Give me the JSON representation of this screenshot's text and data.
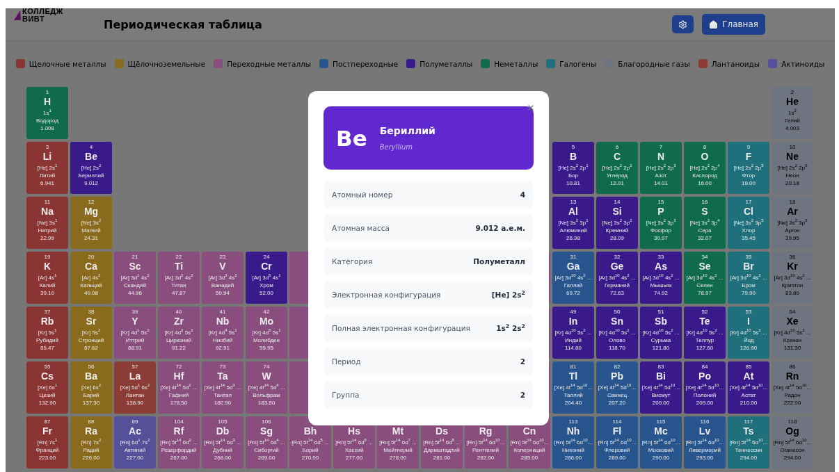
{
  "header": {
    "logo": [
      "КОЛЛЕДЖ",
      "ВИВТ"
    ],
    "title": "Периодическая таблица",
    "buttons": [
      {
        "kind": "settings"
      },
      {
        "kind": "home",
        "label": "Главная"
      }
    ]
  },
  "legend": [
    {
      "label": "Щелочные металлы",
      "color": "#8a3434"
    },
    {
      "label": "Щёлочноземельные",
      "color": "#8a6a1c"
    },
    {
      "label": "Переходные металлы",
      "color": "#8a4e7e"
    },
    {
      "label": "Постпереходные",
      "color": "#28558e"
    },
    {
      "label": "Полуметаллы",
      "color": "#3a1a8a"
    },
    {
      "label": "Неметаллы",
      "color": "#106a4c"
    },
    {
      "label": "Галогены",
      "color": "#1f6f7c"
    },
    {
      "label": "Благородные газы",
      "color": "#6e7480"
    },
    {
      "label": "Лантаноиды",
      "color": "#8c3c36"
    },
    {
      "label": "Актиноиды",
      "color": "#55509a"
    }
  ],
  "table": {
    "rows": [
      [
        {
          "kind": "element",
          "color": "#106a4c",
          "number": "1",
          "symbol": "H",
          "config": "1s$^{1}$",
          "name": "Водород",
          "mass": "1.008"
        },
        {
          "kind": "empty"
        },
        {
          "kind": "empty"
        },
        {
          "kind": "empty"
        },
        {
          "kind": "empty"
        },
        {
          "kind": "empty"
        },
        {
          "kind": "empty"
        },
        {
          "kind": "empty"
        },
        {
          "kind": "empty"
        },
        {
          "kind": "empty"
        },
        {
          "kind": "empty"
        },
        {
          "kind": "empty"
        },
        {
          "kind": "empty"
        },
        {
          "kind": "empty"
        },
        {
          "kind": "empty"
        },
        {
          "kind": "empty"
        },
        {
          "kind": "empty"
        },
        {
          "kind": "element",
          "color": "#6e7480",
          "number": "2",
          "symbol": "He",
          "config": "1s$^{2}$",
          "name": "Гелий",
          "mass": "4.003"
        }
      ],
      [
        {
          "kind": "element",
          "color": "#8a3434",
          "number": "3",
          "symbol": "Li",
          "config": "[He] 2s$^{1}$",
          "name": "Литий",
          "mass": "6.941"
        },
        {
          "kind": "element",
          "color": "#3a1a8a",
          "number": "4",
          "symbol": "Be",
          "config": "[He] 2s$^{2}$",
          "name": "Бериллий",
          "mass": "9.012"
        },
        {
          "kind": "empty"
        },
        {
          "kind": "empty"
        },
        {
          "kind": "empty"
        },
        {
          "kind": "empty"
        },
        {
          "kind": "empty"
        },
        {
          "kind": "empty"
        },
        {
          "kind": "empty"
        },
        {
          "kind": "empty"
        },
        {
          "kind": "empty"
        },
        {
          "kind": "empty"
        },
        {
          "kind": "element",
          "color": "#3a1a8a",
          "number": "5",
          "symbol": "B",
          "config": "[He] 2s$^{2}$ 2p$^{1}$",
          "name": "Бор",
          "mass": "10.81"
        },
        {
          "kind": "element",
          "color": "#106a4c",
          "number": "6",
          "symbol": "C",
          "config": "[He] 2s$^{2}$ 2p$^{2}$",
          "name": "Углерод",
          "mass": "12.01"
        },
        {
          "kind": "element",
          "color": "#106a4c",
          "number": "7",
          "symbol": "N",
          "config": "[He] 2s$^{2}$ 2p$^{3}$",
          "name": "Азот",
          "mass": "14.01"
        },
        {
          "kind": "element",
          "color": "#106a4c",
          "number": "8",
          "symbol": "O",
          "config": "[He] 2s$^{2}$ 2p$^{4}$",
          "name": "Кислород",
          "mass": "16.00"
        },
        {
          "kind": "element",
          "color": "#1f6f7c",
          "number": "9",
          "symbol": "F",
          "config": "[He] 2s$^{2}$ 2p$^{5}$",
          "name": "Фтор",
          "mass": "19.00"
        },
        {
          "kind": "element",
          "color": "#6e7480",
          "number": "10",
          "symbol": "Ne",
          "config": "[He] 2s$^{2}$ 2p$^{6}$",
          "name": "Неон",
          "mass": "20.18"
        }
      ],
      [
        {
          "kind": "element",
          "color": "#8a3434",
          "number": "11",
          "symbol": "Na",
          "config": "[Ne] 3s$^{1}$",
          "name": "Натрий",
          "mass": "22.99"
        },
        {
          "kind": "element",
          "color": "#8a6a1c",
          "number": "12",
          "symbol": "Mg",
          "config": "[Ne] 3s$^{2}$",
          "name": "Магний",
          "mass": "24.31"
        },
        {
          "kind": "empty"
        },
        {
          "kind": "empty"
        },
        {
          "kind": "empty"
        },
        {
          "kind": "empty"
        },
        {
          "kind": "empty"
        },
        {
          "kind": "empty"
        },
        {
          "kind": "empty"
        },
        {
          "kind": "empty"
        },
        {
          "kind": "empty"
        },
        {
          "kind": "empty"
        },
        {
          "kind": "element",
          "color": "#3a1a8a",
          "number": "13",
          "symbol": "Al",
          "config": "[Ne] 3s$^{2}$ 3p$^{1}$",
          "name": "Алюминий",
          "mass": "26.98"
        },
        {
          "kind": "element",
          "color": "#3a1a8a",
          "number": "14",
          "symbol": "Si",
          "config": "[Ne] 3s$^{2}$ 3p$^{2}$",
          "name": "Кремний",
          "mass": "28.09"
        },
        {
          "kind": "element",
          "color": "#106a4c",
          "number": "15",
          "symbol": "P",
          "config": "[Ne] 3s$^{2}$ 3p$^{3}$",
          "name": "Фосфор",
          "mass": "30.97"
        },
        {
          "kind": "element",
          "color": "#106a4c",
          "number": "16",
          "symbol": "S",
          "config": "[Ne] 3s$^{2}$ 3p$^{4}$",
          "name": "Сера",
          "mass": "32.07"
        },
        {
          "kind": "element",
          "color": "#1f6f7c",
          "number": "17",
          "symbol": "Cl",
          "config": "[Ne] 3s$^{2}$ 3p$^{5}$",
          "name": "Хлор",
          "mass": "35.45"
        },
        {
          "kind": "element",
          "color": "#6e7480",
          "number": "18",
          "symbol": "Ar",
          "config": "[Ne] 3s$^{2}$ 3p$^{6}$",
          "name": "Аргон",
          "mass": "39.95"
        }
      ],
      [
        {
          "kind": "element",
          "color": "#8a3434",
          "number": "19",
          "symbol": "K",
          "config": "[Ar] 4s$^{1}$",
          "name": "Калий",
          "mass": "39.10"
        },
        {
          "kind": "element",
          "color": "#8a6a1c",
          "number": "20",
          "symbol": "Ca",
          "config": "[Ar] 4s$^{2}$",
          "name": "Кальций",
          "mass": "40.08"
        },
        {
          "kind": "element",
          "color": "#8a4e7e",
          "number": "21",
          "symbol": "Sc",
          "config": "[Ar] 3d$^{1}$ 4s$^{2}$",
          "name": "Скандий",
          "mass": "44.96"
        },
        {
          "kind": "element",
          "color": "#8a4e7e",
          "number": "22",
          "symbol": "Ti",
          "config": "[Ar] 3d$^{2}$ 4s$^{2}$",
          "name": "Титан",
          "mass": "47.87"
        },
        {
          "kind": "element",
          "color": "#8a4e7e",
          "number": "23",
          "symbol": "V",
          "config": "[Ar] 3d$^{3}$ 4s$^{2}$",
          "name": "Ванадий",
          "mass": "50.94"
        },
        {
          "kind": "element",
          "color": "#3a1a8a",
          "number": "24",
          "symbol": "Cr",
          "config": "[Ar] 3d$^{5}$ 4s$^{1}$",
          "name": "Хром",
          "mass": "52.00"
        },
        {
          "kind": "covered",
          "color": "#8a4e7e"
        },
        {
          "kind": "empty"
        },
        {
          "kind": "empty"
        },
        {
          "kind": "empty"
        },
        {
          "kind": "empty"
        },
        {
          "kind": "covered",
          "color": "#8a4e7e"
        },
        {
          "kind": "element",
          "color": "#28558e",
          "number": "31",
          "symbol": "Ga",
          "config": "[Ar] 3d$^{10}$ 4s$^{2}$ ...",
          "name": "Галлий",
          "mass": "69.72"
        },
        {
          "kind": "element",
          "color": "#3a1a8a",
          "number": "32",
          "symbol": "Ge",
          "config": "[Ar] 3d$^{10}$ 4s$^{2}$ ...",
          "name": "Германий",
          "mass": "72.63"
        },
        {
          "kind": "element",
          "color": "#3a1a8a",
          "number": "33",
          "symbol": "As",
          "config": "[Ar] 3d$^{10}$ 4s$^{2}$ ...",
          "name": "Мышьяк",
          "mass": "74.92"
        },
        {
          "kind": "element",
          "color": "#106a4c",
          "number": "34",
          "symbol": "Se",
          "config": "[Ar] 3d$^{10}$ 4s$^{2}$ ...",
          "name": "Селен",
          "mass": "78.97"
        },
        {
          "kind": "element",
          "color": "#1f6f7c",
          "number": "35",
          "symbol": "Br",
          "config": "[Ar] 3d$^{10}$ 4s$^{2}$ ...",
          "name": "Бром",
          "mass": "79.90"
        },
        {
          "kind": "element",
          "color": "#6e7480",
          "number": "36",
          "symbol": "Kr",
          "config": "[Ar] 3d$^{10}$ 4s$^{2}$ ...",
          "name": "Криптон",
          "mass": "83.80"
        }
      ],
      [
        {
          "kind": "element",
          "color": "#8a3434",
          "number": "37",
          "symbol": "Rb",
          "config": "[Kr] 5s$^{1}$",
          "name": "Рубидий",
          "mass": "85.47"
        },
        {
          "kind": "element",
          "color": "#8a6a1c",
          "number": "38",
          "symbol": "Sr",
          "config": "[Kr] 5s$^{2}$",
          "name": "Стронций",
          "mass": "87.62"
        },
        {
          "kind": "element",
          "color": "#8a4e7e",
          "number": "39",
          "symbol": "Y",
          "config": "[Kr] 4d$^{1}$ 5s$^{2}$",
          "name": "Иттрий",
          "mass": "88.91"
        },
        {
          "kind": "element",
          "color": "#8a4e7e",
          "number": "40",
          "symbol": "Zr",
          "config": "[Kr] 4d$^{2}$ 5s$^{2}$",
          "name": "Цирконий",
          "mass": "91.22"
        },
        {
          "kind": "element",
          "color": "#8a4e7e",
          "number": "41",
          "symbol": "Nb",
          "config": "[Kr] 4d$^{4}$ 5s$^{1}$",
          "name": "Ниобий",
          "mass": "92.91"
        },
        {
          "kind": "element",
          "color": "#8a4e7e",
          "number": "42",
          "symbol": "Mo",
          "config": "[Kr] 4d$^{5}$ 5s$^{1}$",
          "name": "Молибден",
          "mass": "95.95"
        },
        {
          "kind": "covered",
          "color": "#8a4e7e"
        },
        {
          "kind": "empty"
        },
        {
          "kind": "empty"
        },
        {
          "kind": "empty"
        },
        {
          "kind": "empty"
        },
        {
          "kind": "covered",
          "color": "#8a4e7e"
        },
        {
          "kind": "element",
          "color": "#3a1a8a",
          "number": "49",
          "symbol": "In",
          "config": "[Kr] 4d$^{10}$ 5s$^{2}$ ...",
          "name": "Индий",
          "mass": "114.80"
        },
        {
          "kind": "element",
          "color": "#3a1a8a",
          "number": "50",
          "symbol": "Sn",
          "config": "[Kr] 4d$^{10}$ 5s$^{2}$ ...",
          "name": "Олово",
          "mass": "118.70"
        },
        {
          "kind": "element",
          "color": "#3a1a8a",
          "number": "51",
          "symbol": "Sb",
          "config": "[Kr] 4d$^{10}$ 5s$^{2}$ ...",
          "name": "Сурьма",
          "mass": "121.80"
        },
        {
          "kind": "element",
          "color": "#3a1a8a",
          "number": "52",
          "symbol": "Te",
          "config": "[Kr] 4d$^{10}$ 5s$^{2}$ ...",
          "name": "Теллур",
          "mass": "127.60"
        },
        {
          "kind": "element",
          "color": "#1f6f7c",
          "number": "53",
          "symbol": "I",
          "config": "[Kr] 4d$^{10}$ 5s$^{2}$ ...",
          "name": "Йод",
          "mass": "126.90"
        },
        {
          "kind": "element",
          "color": "#6e7480",
          "number": "54",
          "symbol": "Xe",
          "config": "[Kr] 4d$^{10}$ 5s$^{2}$ ...",
          "name": "Ксенон",
          "mass": "131.30"
        }
      ],
      [
        {
          "kind": "element",
          "color": "#8a3434",
          "number": "55",
          "symbol": "Cs",
          "config": "[Xe] 6s$^{1}$",
          "name": "Цезий",
          "mass": "132.90"
        },
        {
          "kind": "element",
          "color": "#8a6a1c",
          "number": "56",
          "symbol": "Ba",
          "config": "[Xe] 6s$^{2}$",
          "name": "Барий",
          "mass": "137.30"
        },
        {
          "kind": "element",
          "color": "#8c3c36",
          "number": "57",
          "symbol": "La",
          "config": "[Xe] 5d$^{1}$ 6s$^{2}$",
          "name": "Лантан",
          "mass": "138.90"
        },
        {
          "kind": "element",
          "color": "#8a4e7e",
          "number": "72",
          "symbol": "Hf",
          "config": "[Xe] 4f$^{14}$ 5d$^{2}$ ...",
          "name": "Гафний",
          "mass": "178.50"
        },
        {
          "kind": "element",
          "color": "#8a4e7e",
          "number": "73",
          "symbol": "Ta",
          "config": "[Xe] 4f$^{14}$ 5d$^{3}$ ...",
          "name": "Тантал",
          "mass": "180.90"
        },
        {
          "kind": "element",
          "color": "#8a4e7e",
          "number": "74",
          "symbol": "W",
          "config": "[Xe] 4f$^{14}$ 5d$^{4}$ ...",
          "name": "Вольфрам",
          "mass": "183.80"
        },
        {
          "kind": "covered",
          "color": "#8a4e7e"
        },
        {
          "kind": "empty"
        },
        {
          "kind": "empty"
        },
        {
          "kind": "empty"
        },
        {
          "kind": "empty"
        },
        {
          "kind": "covered",
          "color": "#8a4e7e"
        },
        {
          "kind": "element",
          "color": "#28558e",
          "number": "81",
          "symbol": "Tl",
          "config": "[Xe] 4f$^{14}$ 5d$^{10}$...",
          "name": "Таллий",
          "mass": "204.40"
        },
        {
          "kind": "element",
          "color": "#28558e",
          "number": "82",
          "symbol": "Pb",
          "config": "[Xe] 4f$^{14}$ 5d$^{10}$...",
          "name": "Свинец",
          "mass": "207.20"
        },
        {
          "kind": "element",
          "color": "#3a1a8a",
          "number": "83",
          "symbol": "Bi",
          "config": "[Xe] 4f$^{14}$ 5d$^{10}$...",
          "name": "Висмут",
          "mass": "209.00"
        },
        {
          "kind": "element",
          "color": "#3a1a8a",
          "number": "84",
          "symbol": "Po",
          "config": "[Xe] 4f$^{14}$ 5d$^{10}$...",
          "name": "Полоний",
          "mass": "209.00"
        },
        {
          "kind": "element",
          "color": "#3a1a8a",
          "number": "85",
          "symbol": "At",
          "config": "[Xe] 4f$^{14}$ 5d$^{10}$...",
          "name": "Астат",
          "mass": "210.00"
        },
        {
          "kind": "element",
          "color": "#6e7480",
          "number": "86",
          "symbol": "Rn",
          "config": "[Xe] 4f$^{14}$ 5d$^{10}$...",
          "name": "Радон",
          "mass": "222.00"
        }
      ],
      [
        {
          "kind": "element",
          "color": "#8a3434",
          "number": "87",
          "symbol": "Fr",
          "config": "[Rn] 7s$^{1}$",
          "name": "Франций",
          "mass": "223.00"
        },
        {
          "kind": "element",
          "color": "#8a6a1c",
          "number": "88",
          "symbol": "Ra",
          "config": "[Rn] 7s$^{2}$",
          "name": "Радий",
          "mass": "226.00"
        },
        {
          "kind": "element",
          "color": "#55509a",
          "number": "89",
          "symbol": "Ac",
          "config": "[Rn] 6d$^{1}$ 7s$^{2}$",
          "name": "Актиний",
          "mass": "227.00"
        },
        {
          "kind": "element",
          "color": "#8a4e7e",
          "number": "104",
          "symbol": "Rf",
          "config": "[Rn] 5f$^{14}$ 6d$^{2}$ ...",
          "name": "Резерфордий",
          "mass": "267.00"
        },
        {
          "kind": "element",
          "color": "#8a4e7e",
          "number": "105",
          "symbol": "Db",
          "config": "[Rn] 5f$^{14}$ 6d$^{3}$ ...",
          "name": "Дубний",
          "mass": "268.00"
        },
        {
          "kind": "element",
          "color": "#8a4e7e",
          "number": "106",
          "symbol": "Sg",
          "config": "[Rn] 5f$^{14}$ 6d$^{4}$ ...",
          "name": "Сиборгий",
          "mass": "269.00"
        },
        {
          "kind": "element",
          "color": "#8a4e7e",
          "symbol": "Bh",
          "config": "[Rn] 5f$^{14}$ 6d$^{5}$ ...",
          "name": "Борий",
          "mass": "270.00"
        },
        {
          "kind": "element",
          "color": "#8a4e7e",
          "symbol": "Hs",
          "config": "[Rn] 5f$^{14}$ 6d$^{6}$ ...",
          "name": "Хассий",
          "mass": "277.00"
        },
        {
          "kind": "element",
          "color": "#8a4e7e",
          "symbol": "Mt",
          "config": "[Rn] 5f$^{14}$ 6d$^{7}$ ...",
          "name": "Мейтнерий",
          "mass": "278.00"
        },
        {
          "kind": "element",
          "color": "#8a4e7e",
          "symbol": "Ds",
          "config": "[Rn] 5f$^{14}$ 6d$^{8}$ ...",
          "name": "Дармштадтий",
          "mass": "281.00"
        },
        {
          "kind": "element",
          "color": "#8a4e7e",
          "symbol": "Rg",
          "config": "[Rn] 5f$^{14}$ 6d$^{10}$...",
          "name": "Рентгений",
          "mass": "282.00"
        },
        {
          "kind": "element",
          "color": "#8a4e7e",
          "symbol": "Cn",
          "config": "[Rn] 5f$^{14}$ 6d$^{10}$...",
          "name": "Коперниций",
          "mass": "285.00"
        },
        {
          "kind": "element",
          "color": "#28558e",
          "number": "113",
          "symbol": "Nh",
          "config": "[Rn] 5f$^{14}$ 6d$^{10}$...",
          "name": "Нихоний",
          "mass": "286.00"
        },
        {
          "kind": "element",
          "color": "#28558e",
          "number": "114",
          "symbol": "Fl",
          "config": "[Rn] 5f$^{14}$ 6d$^{10}$...",
          "name": "Флеровий",
          "mass": "289.00"
        },
        {
          "kind": "element",
          "color": "#28558e",
          "number": "115",
          "symbol": "Mc",
          "config": "[Rn] 5f$^{14}$ 6d$^{10}$...",
          "name": "Московий",
          "mass": "290.00"
        },
        {
          "kind": "element",
          "color": "#28558e",
          "number": "116",
          "symbol": "Lv",
          "config": "[Rn] 5f$^{14}$ 6d$^{10}$...",
          "name": "Ливерморий",
          "mass": "293.00"
        },
        {
          "kind": "element",
          "color": "#1f6f7c",
          "number": "117",
          "symbol": "Ts",
          "config": "[Rn] 5f$^{14}$ 6d$^{10}$...",
          "name": "Теннессин",
          "mass": "294.00"
        },
        {
          "kind": "element",
          "color": "#6e7480",
          "number": "118",
          "symbol": "Og",
          "config": "[Rn] 5f$^{14}$ 6d$^{10}$...",
          "name": "Оганесон",
          "mass": "294.00"
        }
      ]
    ]
  },
  "modal": {
    "color": "#6228d0",
    "symbol": "Be",
    "name": "Бериллий",
    "latin_name": "Beryllium",
    "rows": [
      {
        "label": "Атомный номер",
        "value": "4"
      },
      {
        "label": "Атомная масса",
        "value": "9.012 а.е.м."
      },
      {
        "label": "Категория",
        "value": "Полуметалл"
      },
      {
        "label": "Электронная конфигурация",
        "value": "[He] 2s$^{2}$"
      },
      {
        "label": "Полная электронная конфигурация",
        "value": "1s$^{2}$ 2s$^{2}$"
      },
      {
        "label": "Период",
        "value": "2"
      },
      {
        "label": "Группа",
        "value": "2"
      }
    ]
  }
}
